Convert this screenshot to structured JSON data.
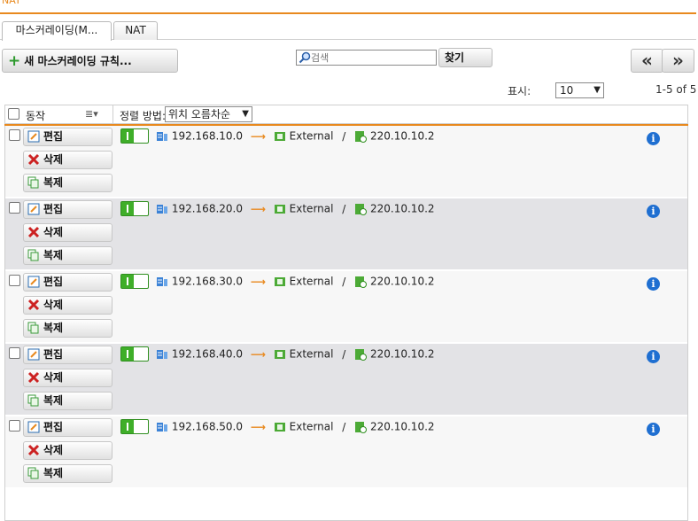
{
  "page": {
    "title": "NAT"
  },
  "tabs": [
    {
      "label": "마스커레이딩(M..."
    },
    {
      "label": "NAT"
    }
  ],
  "toolbar": {
    "add_label": "새 마스커레이딩 규칙...",
    "search_placeholder": "검색",
    "find_label": "찾기",
    "first_label": "«",
    "last_label": "»"
  },
  "paging": {
    "show_label": "표시:",
    "page_size": "10",
    "range": "1-5 of 5"
  },
  "table": {
    "header_action": "동작",
    "sort_label": "정렬 방법:",
    "sort_value": "위치 오름차순"
  },
  "row_actions": {
    "edit": "편집",
    "delete": "삭제",
    "copy": "복제"
  },
  "rows": [
    {
      "network": "192.168.10.0",
      "interface": "External",
      "address": "220.10.10.2"
    },
    {
      "network": "192.168.20.0",
      "interface": "External",
      "address": "220.10.10.2"
    },
    {
      "network": "192.168.30.0",
      "interface": "External",
      "address": "220.10.10.2"
    },
    {
      "network": "192.168.40.0",
      "interface": "External",
      "address": "220.10.10.2"
    },
    {
      "network": "192.168.50.0",
      "interface": "External",
      "address": "220.10.10.2"
    }
  ],
  "colors": {
    "accent": "#e8891e",
    "toggle_on": "#3fae29",
    "info": "#1f6fd1"
  }
}
